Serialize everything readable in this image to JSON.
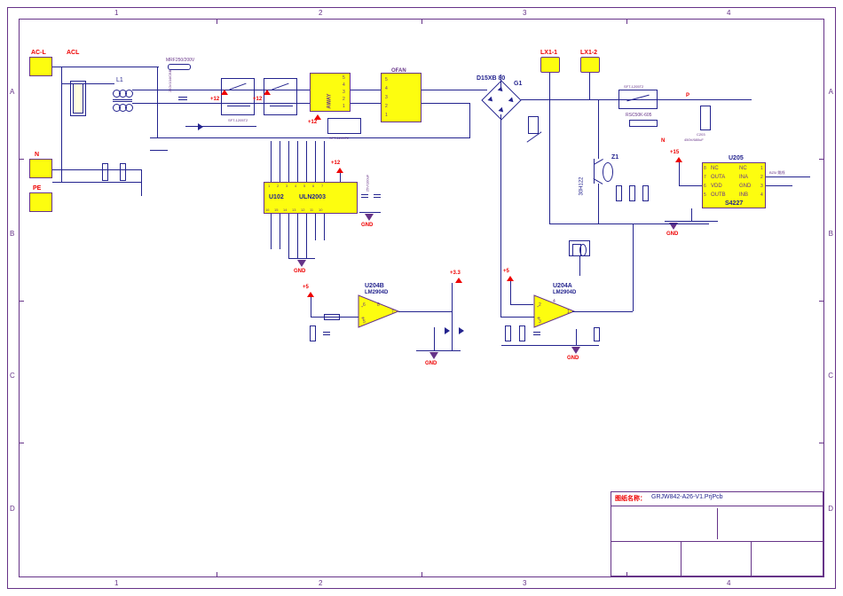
{
  "border": {
    "cols": [
      "1",
      "2",
      "3",
      "4"
    ],
    "rows": [
      "A",
      "B",
      "C",
      "D"
    ]
  },
  "connectors": {
    "acl": "AC-L",
    "acl_net": "ACL",
    "n": "N",
    "pe": "PE",
    "lx1_1": "LX1-1",
    "lx1_2": "LX1-2"
  },
  "components": {
    "l1": "L1",
    "u102_ref": "U102",
    "u102_part": "ULN2003",
    "u204b_ref": "U204B",
    "u204a_ref": "U204A",
    "lm2904": "LM2904D",
    "u205_ref": "U205",
    "u205_part": "S4227",
    "g1": "G1",
    "d15xb": "D15XB 80",
    "z1": "Z1",
    "z1_part": "30H122",
    "ofan": "OFAN",
    "away": "AWAY"
  },
  "nets": {
    "p12": "+12",
    "p5": "+5",
    "p15": "+15",
    "p3v3": "+3.3",
    "gnd": "GND",
    "p": "P",
    "n": "N"
  },
  "u205_pins": {
    "l": [
      "NC",
      "OUTA",
      "VDD",
      "OUTB"
    ],
    "r": [
      "NC",
      "INA",
      "GND",
      "INB"
    ],
    "ln": [
      "8",
      "7",
      "6",
      "5"
    ],
    "rn": [
      "1",
      "2",
      "3",
      "4"
    ]
  },
  "u102_pins_top": [
    "1",
    "2",
    "3",
    "4",
    "5",
    "6",
    "7"
  ],
  "u102_pins_bot": [
    "16",
    "15",
    "14",
    "13",
    "12",
    "11",
    "10"
  ],
  "ofan_pins": [
    "5",
    "4",
    "3",
    "2",
    "1"
  ],
  "away_pins": [
    "5",
    "4",
    "3",
    "2",
    "1"
  ],
  "misc": {
    "rsc50k": "RSC50K-605",
    "cbb": "250V104/CBB",
    "jump": "跳线",
    "bz_jump": "BZ5/  跳线"
  },
  "title_block": {
    "label": "图纸名称：",
    "name": "GRJW842-A26-V1.PrjPcb"
  }
}
